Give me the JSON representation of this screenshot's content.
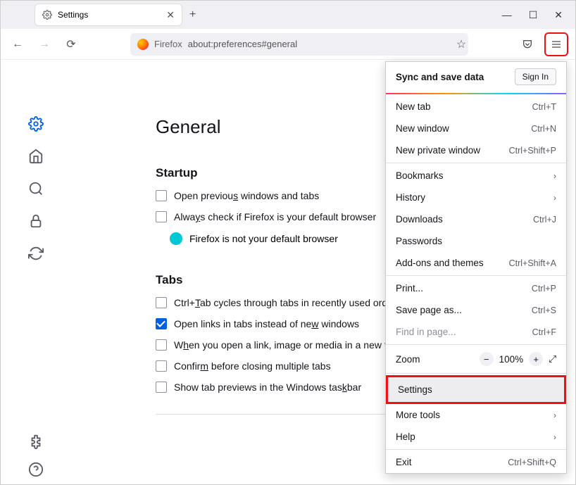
{
  "tab": {
    "title": "Settings"
  },
  "urlbar": {
    "scheme": "Firefox",
    "path": "about:preferences#general"
  },
  "page": {
    "heading": "General",
    "startup": {
      "title": "Startup",
      "openPrevious_pre": "Open previou",
      "openPrevious_u": "s",
      "openPrevious_post": " windows and tabs",
      "alwaysCheck_pre": "Alwa",
      "alwaysCheck_u": "y",
      "alwaysCheck_post": "s check if Firefox is your default browser",
      "notDefault": "Firefox is not your default browser"
    },
    "tabs": {
      "title": "Tabs",
      "ctrlTab_pre": "Ctrl+",
      "ctrlTab_u": "T",
      "ctrlTab_post": "ab cycles through tabs in recently used order",
      "openLinks_pre": "Open links in tabs instead of ne",
      "openLinks_u": "w",
      "openLinks_post": " windows",
      "switchTo_pre": "W",
      "switchTo_u": "h",
      "switchTo_post": "en you open a link, image or media in a new tab, switch to it",
      "confirm_pre": "Confir",
      "confirm_u": "m",
      "confirm_post": " before closing multiple tabs",
      "taskbar_pre": "Show tab previews in the Windows tas",
      "taskbar_u": "k",
      "taskbar_post": "bar"
    }
  },
  "menu": {
    "sync": "Sync and save data",
    "signIn": "Sign In",
    "newTab": "New tab",
    "newTabKey": "Ctrl+T",
    "newWindow": "New window",
    "newWindowKey": "Ctrl+N",
    "newPrivate": "New private window",
    "newPrivateKey": "Ctrl+Shift+P",
    "bookmarks": "Bookmarks",
    "history": "History",
    "downloads": "Downloads",
    "downloadsKey": "Ctrl+J",
    "passwords": "Passwords",
    "addons": "Add-ons and themes",
    "addonsKey": "Ctrl+Shift+A",
    "print": "Print...",
    "printKey": "Ctrl+P",
    "savePage": "Save page as...",
    "savePageKey": "Ctrl+S",
    "findInPage": "Find in page...",
    "findInPageKey": "Ctrl+F",
    "zoom": "Zoom",
    "zoomValue": "100%",
    "settings": "Settings",
    "moreTools": "More tools",
    "help": "Help",
    "exit": "Exit",
    "exitKey": "Ctrl+Shift+Q"
  }
}
